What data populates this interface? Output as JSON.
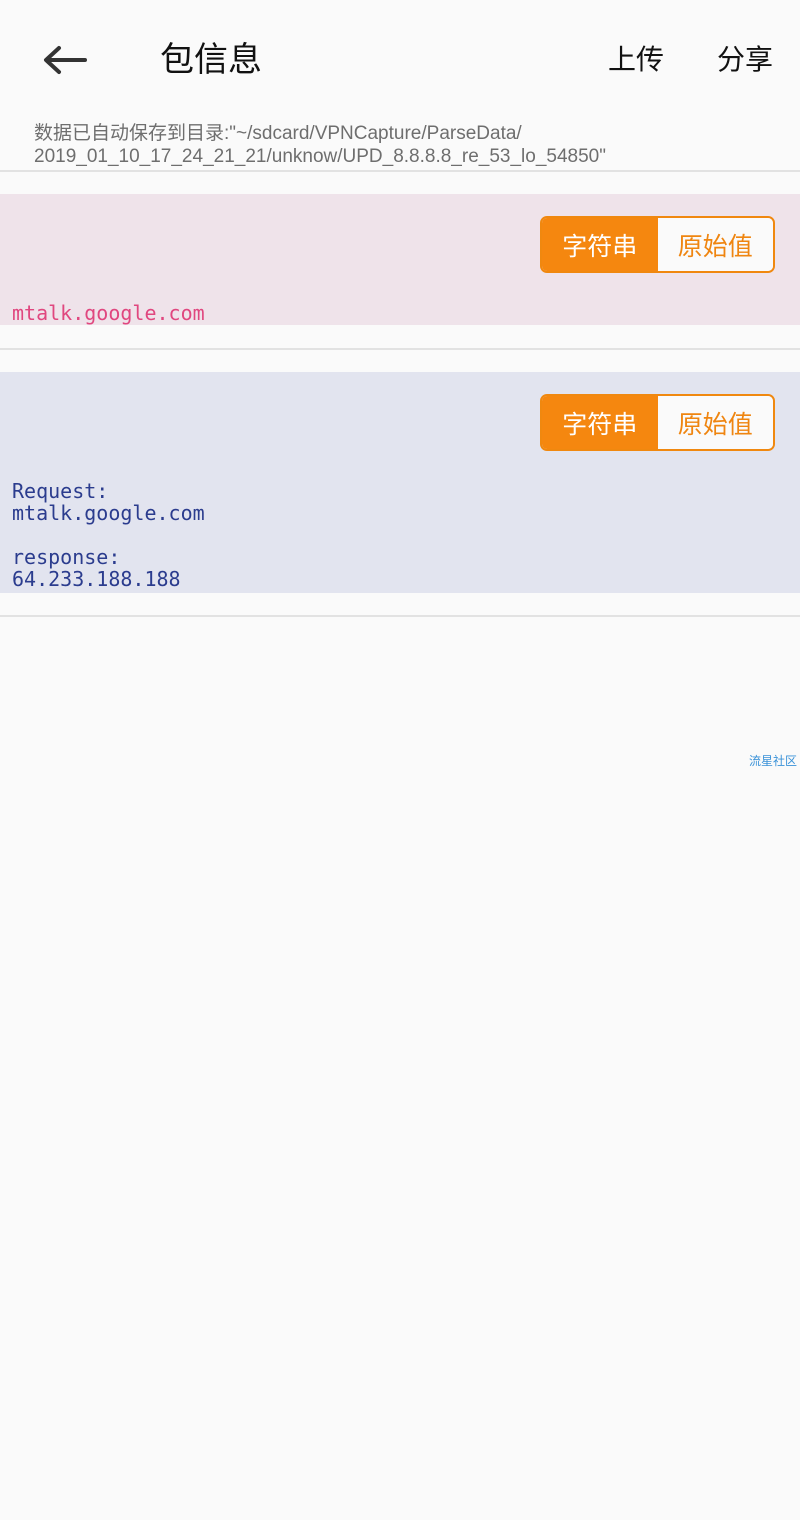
{
  "appbar": {
    "title": "包信息",
    "back_icon": "arrow-left-icon",
    "upload_label": "上传",
    "share_label": "分享"
  },
  "save_path": "数据已自动保存到目录:\"~/sdcard/VPNCapture/ParseData/\n2019_01_10_17_24_21_21/unknow/UPD_8.8.8.8_re_53_lo_54850\"",
  "request_panel": {
    "segment": {
      "string_label": "字符串",
      "raw_label": "原始值",
      "selected": "字符串"
    },
    "content": "mtalk.google.com",
    "text_color": "#e0477f",
    "background": "#efe3ea"
  },
  "response_panel": {
    "segment": {
      "string_label": "字符串",
      "raw_label": "原始值",
      "selected": "字符串"
    },
    "content": "Request:\nmtalk.google.com\n\nresponse:\n64.233.188.188",
    "text_color": "#2b3c8e",
    "background": "#e2e4ef"
  },
  "accent_color": "#f5870f",
  "watermark": "流星社区"
}
